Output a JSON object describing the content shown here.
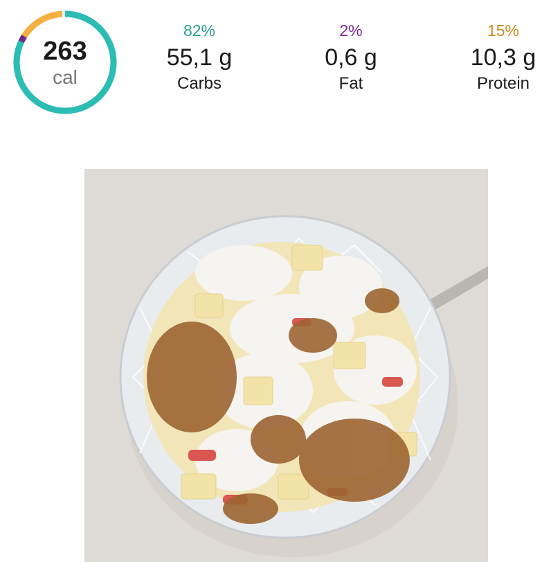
{
  "calories": {
    "value": "263",
    "unit": "cal"
  },
  "ring": {
    "carbs_fraction": 0.82,
    "fat_fraction": 0.02,
    "protein_fraction": 0.15,
    "carbs_color": "#2bbcb3",
    "fat_color": "#6a2a8c",
    "protein_color": "#f5b041",
    "track_color": "#2bbcb3"
  },
  "macros": [
    {
      "id": "carbs",
      "percent": "82%",
      "grams": "55,1 g",
      "label": "Carbs",
      "color": "#2a9d8f"
    },
    {
      "id": "fat",
      "percent": "2%",
      "grams": "0,6 g",
      "label": "Fat",
      "color": "#7b2a8f"
    },
    {
      "id": "protein",
      "percent": "15%",
      "grams": "10,3 g",
      "label": "Protein",
      "color": "#c98a1e"
    }
  ],
  "photo": {
    "subject": "glass bowl of chopped apple with yogurt and cinnamon",
    "background_color": "#dedad5",
    "bowl_color": "#e8ecef",
    "apple_color": "#f2e6b8",
    "yogurt_color": "#f6f4f0",
    "cinnamon_color": "#9c6532",
    "peel_color": "#d9574f"
  }
}
